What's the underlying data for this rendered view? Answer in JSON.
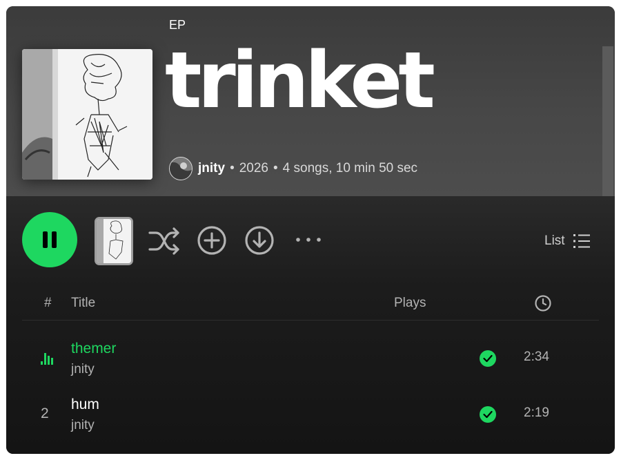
{
  "album": {
    "type_label": "EP",
    "title": "trinket",
    "artist": "jnity",
    "year": "2026",
    "summary": "4 songs, 10 min 50 sec",
    "separator": "•"
  },
  "controls": {
    "list_label": "List",
    "play_state": "playing"
  },
  "table": {
    "headers": {
      "number": "#",
      "title": "Title",
      "plays": "Plays"
    }
  },
  "tracks": [
    {
      "number": "",
      "title": "themer",
      "artist": "jnity",
      "downloaded": true,
      "duration": "2:34",
      "now_playing": true
    },
    {
      "number": "2",
      "title": "hum",
      "artist": "jnity",
      "downloaded": true,
      "duration": "2:19",
      "now_playing": false
    }
  ],
  "colors": {
    "accent": "#1ed760",
    "background": "#121212",
    "hero": "#474747",
    "text_secondary": "#b3b3b3"
  }
}
